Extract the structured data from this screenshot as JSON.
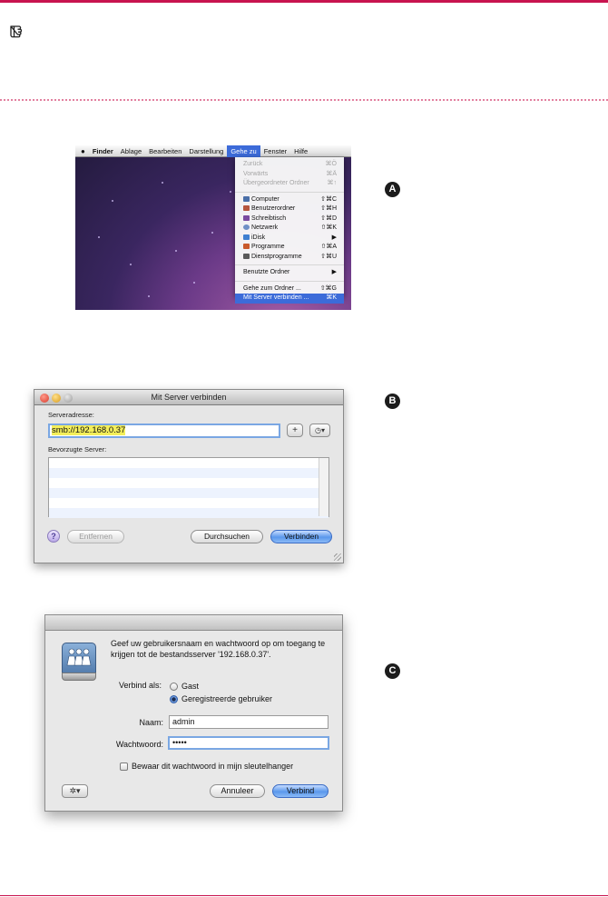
{
  "markers": [
    "A",
    "B",
    "C"
  ],
  "menubar": {
    "apple": "",
    "items": [
      "Finder",
      "Ablage",
      "Bearbeiten",
      "Darstellung",
      "Gehe zu",
      "Fenster",
      "Hilfe"
    ]
  },
  "go_menu": {
    "group1": [
      {
        "label": "Zurück",
        "shortcut": "⌘Ö"
      },
      {
        "label": "Vorwärts",
        "shortcut": "⌘Ä"
      },
      {
        "label": "Übergeordneter Ordner",
        "shortcut": "⌘↑"
      }
    ],
    "group2": [
      {
        "label": "Computer",
        "shortcut": "⇧⌘C"
      },
      {
        "label": "Benutzerordner",
        "shortcut": "⇧⌘H"
      },
      {
        "label": "Schreibtisch",
        "shortcut": "⇧⌘D"
      },
      {
        "label": "Netzwerk",
        "shortcut": "⇧⌘K"
      },
      {
        "label": "iDisk",
        "shortcut": "▶"
      },
      {
        "label": "Programme",
        "shortcut": "⇧⌘A"
      },
      {
        "label": "Dienstprogramme",
        "shortcut": "⇧⌘U"
      }
    ],
    "group3": [
      {
        "label": "Benutzte Ordner",
        "shortcut": "▶"
      }
    ],
    "group4": [
      {
        "label": "Gehe zum Ordner ...",
        "shortcut": "⇧⌘G"
      },
      {
        "label": "Mit Server verbinden ...",
        "shortcut": "⌘K"
      }
    ]
  },
  "connect_dialog": {
    "title": "Mit Server verbinden",
    "server_address_label": "Serveradresse:",
    "server_address_value": "smb://192.168.0.37",
    "add_symbol": "+",
    "recent_symbol": "◷▾",
    "favorites_label": "Bevorzugte Server:",
    "help_symbol": "?",
    "remove_label": "Entfernen",
    "browse_label": "Durchsuchen",
    "connect_label": "Verbinden"
  },
  "login_dialog": {
    "message": "Geef uw gebruikersnaam en wachtwoord op om toegang te krijgen tot de bestandsserver '192.168.0.37'.",
    "connect_as_label": "Verbind als:",
    "option_guest": "Gast",
    "option_registered": "Geregistreerde gebruiker",
    "name_label": "Naam:",
    "name_value": "admin",
    "password_label": "Wachtwoord:",
    "password_value": "•••••",
    "keychain_label": "Bewaar dit wachtwoord in mijn sleutelhanger",
    "gear_symbol": "✲▾",
    "cancel_label": "Annuleer",
    "connect_label": "Verbind"
  },
  "colors": {
    "accent_rule": "#c8134f",
    "menu_highlight": "#3c6bd9",
    "default_button": "#5a98ec"
  }
}
